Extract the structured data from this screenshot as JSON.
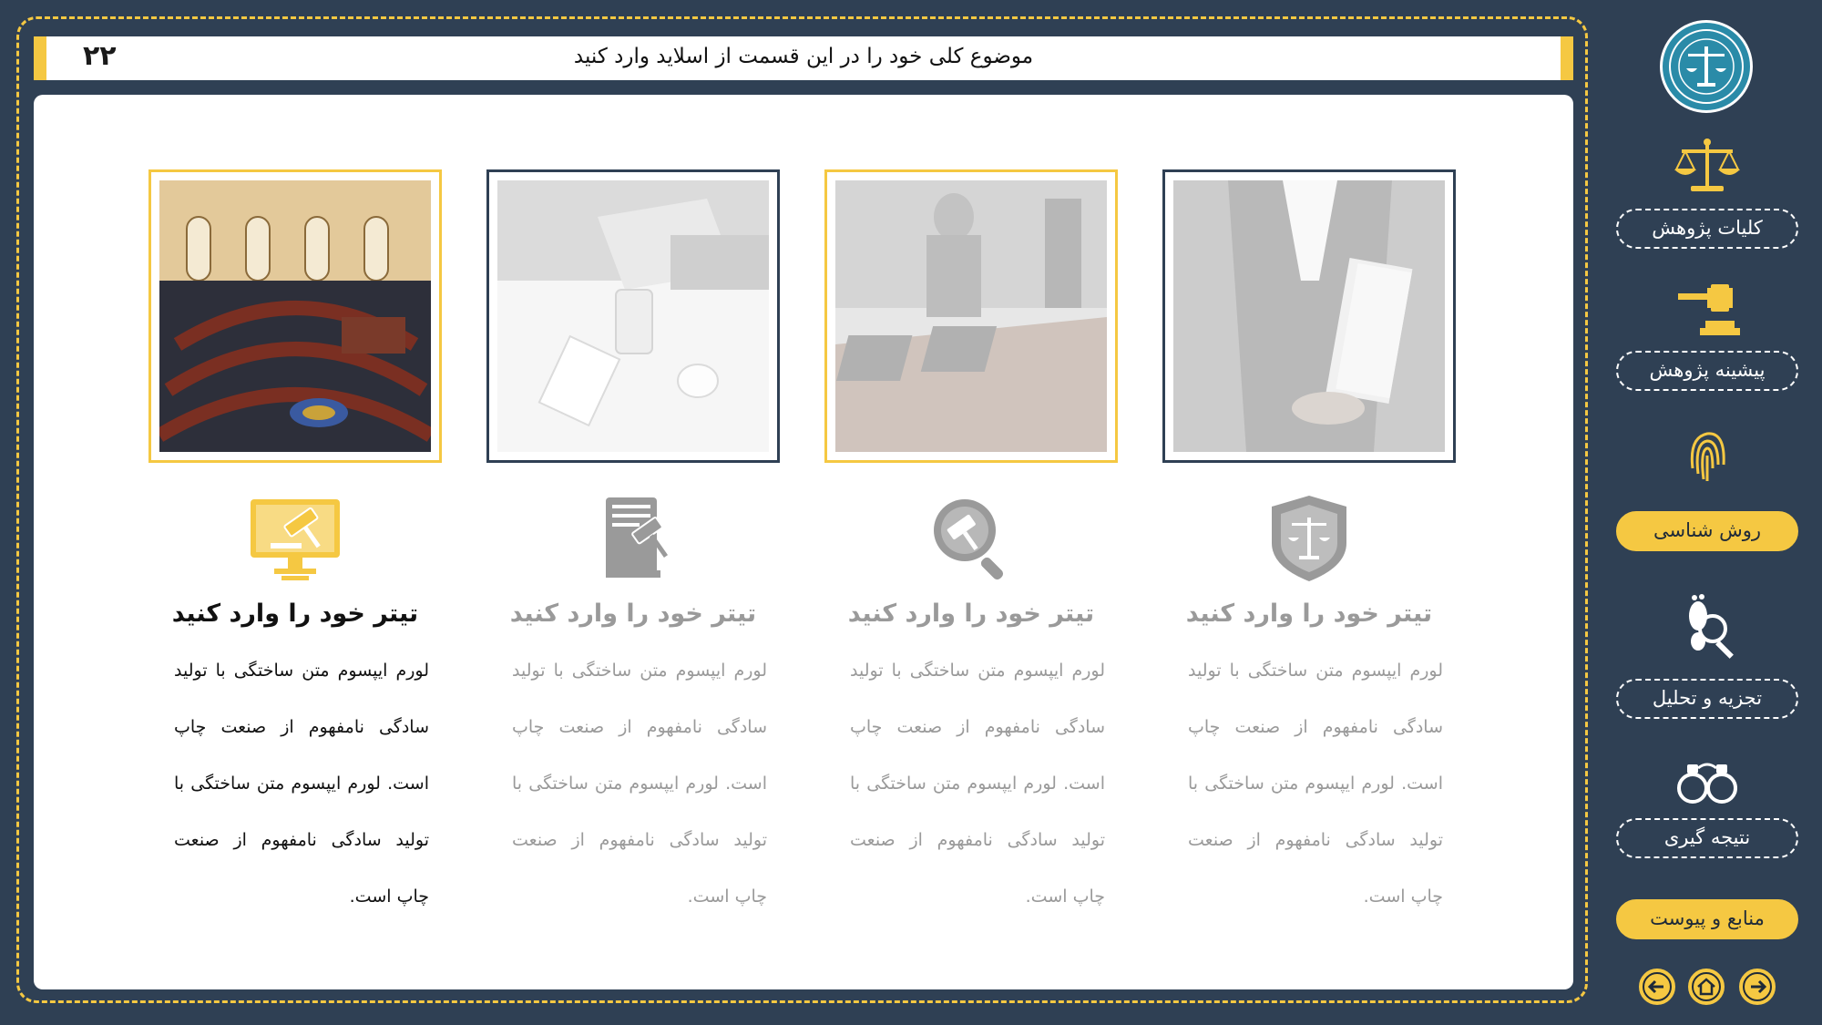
{
  "slide": {
    "number": "۲۲",
    "title": "موضوع کلی خود را در این قسمت از اسلاید وارد کنید"
  },
  "cards": [
    {
      "title": "تیتر خود را وارد کنید",
      "text": "لورم ایپسوم متن ساختگی با تولید سادگی نامفهوم از صنعت چاپ است. لورم ایپسوم متن ساختگی با تولید سادگی نامفهوم از صنعت چاپ است.",
      "icon": "judge-laptop-icon",
      "photo": "courtroom-chamber-photo",
      "state": "active"
    },
    {
      "title": "تیتر خود را وارد کنید",
      "text": "لورم ایپسوم متن ساختگی با تولید سادگی نامفهوم از صنعت چاپ است. لورم ایپسوم متن ساختگی با تولید سادگی نامفهوم از صنعت چاپ است.",
      "icon": "law-book-gavel-icon",
      "photo": "office-desk-laptop-photo",
      "state": "dim"
    },
    {
      "title": "تیتر خود را وارد کنید",
      "text": "لورم ایپسوم متن ساختگی با تولید سادگی نامفهوم از صنعت چاپ است. لورم ایپسوم متن ساختگی با تولید سادگی نامفهوم از صنعت چاپ است.",
      "icon": "gavel-magnifier-icon",
      "photo": "meeting-room-photo",
      "state": "dim"
    },
    {
      "title": "تیتر خود را وارد کنید",
      "text": "لورم ایپسوم متن ساختگی با تولید سادگی نامفهوم از صنعت چاپ است. لورم ایپسوم متن ساختگی با تولید سادگی نامفهوم از صنعت چاپ است.",
      "icon": "scales-shield-icon",
      "photo": "lawyer-books-photo",
      "state": "dim"
    }
  ],
  "sidebar": {
    "items": [
      {
        "label": "کلیات پژوهش",
        "icon": "scales-icon",
        "active": false
      },
      {
        "label": "پیشینه پژوهش",
        "icon": "gavel-icon",
        "active": false
      },
      {
        "label": "روش شناسی",
        "icon": "fingerprint-icon",
        "active": true
      },
      {
        "label": "تجزیه و تحلیل",
        "icon": "footprint-magnifier-icon",
        "active": false
      },
      {
        "label": "نتیجه گیری",
        "icon": "handcuffs-icon",
        "active": false
      },
      {
        "label": "منابع و پیوست",
        "icon": "",
        "active": true
      }
    ],
    "nav": [
      "arrow-left-icon",
      "home-icon",
      "arrow-right-icon"
    ]
  },
  "colors": {
    "background": "#2f4054",
    "accent": "#f5c842",
    "panel": "#ffffff",
    "dim_text": "#9a9a9a"
  }
}
